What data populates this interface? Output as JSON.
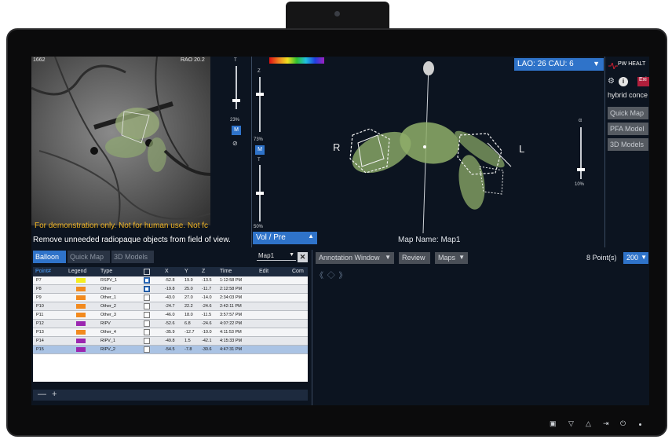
{
  "fluoro": {
    "corner_left": "1662",
    "corner_right": "RAO 20.2",
    "demo_note": "For demonstration only. Not for human use. Not fc",
    "remove_note": "Remove unneeded radiopaque objects from field of view."
  },
  "sliders": {
    "fluoro_top_label": "T",
    "fluoro_percent": "23%",
    "fluoro_m": "M",
    "vp_z_label": "Z",
    "vp_z_percent": "73%",
    "vp_z_m": "M",
    "vp_t_label": "T",
    "vp_t_percent": "50%",
    "right_alpha_label": "α",
    "right_percent": "10%"
  },
  "viewport": {
    "volpre_label": "Vol / Pre",
    "view_angle": "LAO: 26 CAU: 6",
    "left_label": "R",
    "right_label": "L",
    "map_name": "Map Name: Map1"
  },
  "right_panel": {
    "brand": "PW HEALT",
    "exit_label": "Exi",
    "hybrid_label": "hybrid conce",
    "buttons": [
      "Quick Map",
      "PFA Model",
      "3D Models"
    ]
  },
  "tabs": [
    {
      "label": "Balloon",
      "active": true
    },
    {
      "label": "Quick Map",
      "active": false
    },
    {
      "label": "3D Models",
      "active": false
    }
  ],
  "map_select": "Map1",
  "close_label": "✕",
  "table": {
    "headers": [
      "Point#",
      "Legend",
      "Type",
      "X",
      "Y",
      "Z",
      "Time",
      "Edit",
      "Com"
    ],
    "rows": [
      {
        "point": "P7",
        "color": "#f5ee20",
        "type": "RSPV_1",
        "checked": true,
        "x": "-52.8",
        "y": "19.9",
        "z": "-13.5",
        "time": "1:12:58 PM"
      },
      {
        "point": "P8",
        "color": "#f28a1e",
        "type": "Other",
        "checked": true,
        "x": "-19.8",
        "y": "25.0",
        "z": "-11.7",
        "time": "2:12:58 PM"
      },
      {
        "point": "P9",
        "color": "#f28a1e",
        "type": "Other_1",
        "checked": false,
        "x": "-43.0",
        "y": "27.0",
        "z": "-14.0",
        "time": "2:34:03 PM"
      },
      {
        "point": "P10",
        "color": "#f28a1e",
        "type": "Other_2",
        "checked": false,
        "x": "-24.7",
        "y": "22.2",
        "z": "-24.6",
        "time": "2:42:11 PM"
      },
      {
        "point": "P11",
        "color": "#f28a1e",
        "type": "Other_3",
        "checked": false,
        "x": "-46.0",
        "y": "18.0",
        "z": "-11.5",
        "time": "3:57:57 PM"
      },
      {
        "point": "P12",
        "color": "#9b27b0",
        "type": "RIPV",
        "checked": false,
        "x": "-52.6",
        "y": "6.8",
        "z": "-24.6",
        "time": "4:07:22 PM"
      },
      {
        "point": "P13",
        "color": "#f28a1e",
        "type": "Other_4",
        "checked": false,
        "x": "-35.9",
        "y": "-12.7",
        "z": "-10.0",
        "time": "4:11:53 PM"
      },
      {
        "point": "P14",
        "color": "#9b27b0",
        "type": "RIPV_1",
        "checked": false,
        "x": "-49.8",
        "y": "1.5",
        "z": "-42.1",
        "time": "4:15:33 PM"
      },
      {
        "point": "P15",
        "color": "#9b27b0",
        "type": "RIPV_2",
        "checked": false,
        "x": "-54.5",
        "y": "-7.8",
        "z": "-30.6",
        "time": "4:47:31 PM",
        "selected": true
      }
    ]
  },
  "footer": {
    "minus": "—",
    "plus": "+"
  },
  "annotation": {
    "window_label": "Annotation Window",
    "review_label": "Review",
    "maps_label": "Maps",
    "points_count": "8 Point(s)",
    "points_select": "200",
    "nav": "《 ◇ 》"
  },
  "bezel_icons": [
    "save-icon",
    "down-triangle-icon",
    "up-triangle-icon",
    "enter-icon",
    "power-icon"
  ]
}
